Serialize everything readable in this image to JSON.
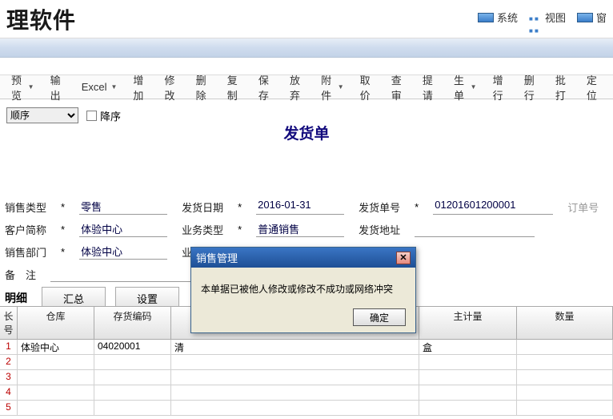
{
  "app": {
    "title_fragment": "理软件"
  },
  "sys_menu": {
    "system": "系统",
    "view": "视图",
    "window_fragment": "窗"
  },
  "toolbar": {
    "preview": "预览",
    "export": "输出",
    "excel": "Excel",
    "add": "增加",
    "edit": "修改",
    "delete": "删除",
    "copy": "复制",
    "save": "保存",
    "discard": "放弃",
    "attach": "附件",
    "price": "取价",
    "review": "查审",
    "submit": "提请",
    "generate": "生单",
    "addrow": "增行",
    "delrow": "删行",
    "batch": "批打",
    "locate": "定位"
  },
  "sort": {
    "label": "顺序",
    "desc_label": "降序"
  },
  "doc_title": "发货单",
  "form": {
    "sale_type_lbl": "销售类型",
    "sale_type_val": "零售",
    "ship_date_lbl": "发货日期",
    "ship_date_val": "2016-01-31",
    "ship_no_lbl": "发货单号",
    "ship_no_val": "01201601200001",
    "order_no_lbl": "订单号",
    "cust_abbr_lbl": "客户简称",
    "cust_abbr_val": "体验中心",
    "biz_type_lbl": "业务类型",
    "biz_type_val": "普通销售",
    "ship_addr_lbl": "发货地址",
    "sale_dept_lbl": "销售部门",
    "sale_dept_val": "体验中心",
    "biz_person_lbl": "业 务 员",
    "remark_lbl": "备　注"
  },
  "detail": {
    "tab": "明细",
    "summary_btn": "汇总",
    "settings_btn": "设置"
  },
  "table": {
    "headers": {
      "seq": "长号",
      "wh": "仓库",
      "code": "存货编码",
      "blank": "",
      "main_qty": "主计量",
      "qty": "数量"
    },
    "rows": [
      {
        "seq": "1",
        "wh": "体验中心",
        "code": "04020001",
        "col3": "清",
        "main_qty": "盒",
        "qty": ""
      }
    ],
    "empty_seqs": [
      "2",
      "3",
      "4",
      "5"
    ]
  },
  "modal": {
    "title": "销售管理",
    "message": "本单据已被他人修改或修改不成功或网络冲突",
    "ok": "确定"
  }
}
